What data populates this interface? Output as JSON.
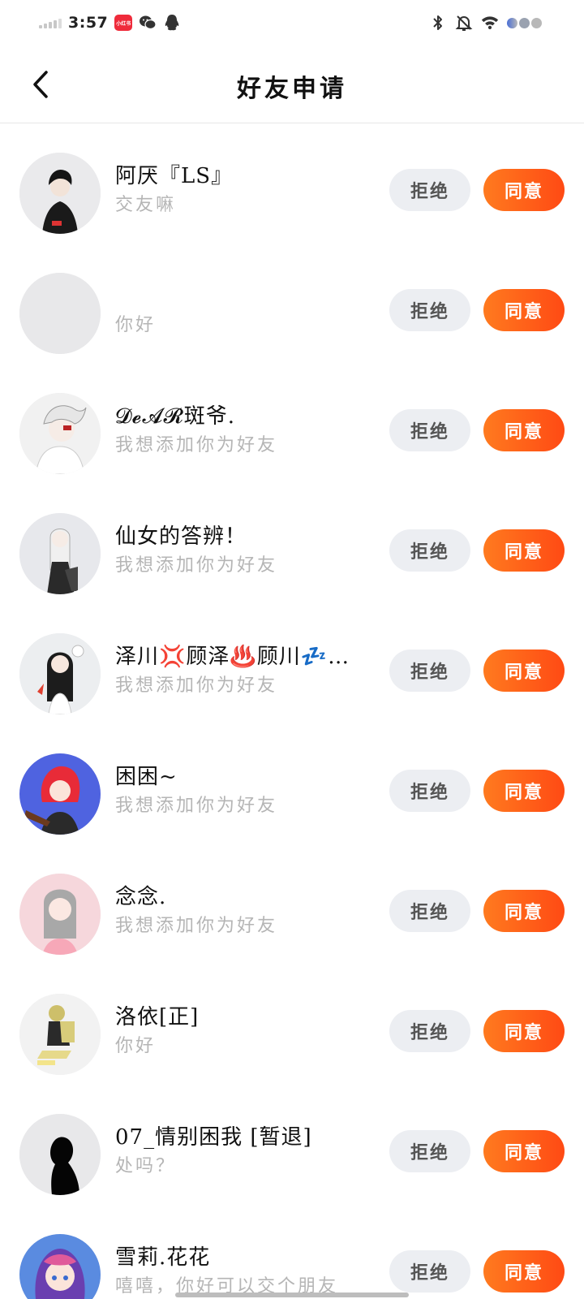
{
  "status_bar": {
    "time": "3:57",
    "app_badge": "小红书",
    "colors": {
      "app_badge": "#ef2b3b",
      "signal": "#c8c8c8"
    }
  },
  "header": {
    "title": "好友申请",
    "back_icon": "chevron-left-icon"
  },
  "requests": [
    {
      "name": "阿厌『LS』",
      "message": "交友嘛",
      "avatar": "anime-boy-black-hoodie"
    },
    {
      "name": "",
      "message": "你好",
      "avatar": "empty-gray"
    },
    {
      "name": "𝓓𝓮𝓐𝓡斑爷.",
      "message": "我想添加你为好友",
      "avatar": "anime-white-hair"
    },
    {
      "name": "仙女的答辨！",
      "message": "我想添加你为好友",
      "avatar": "anime-silver-hair-chair"
    },
    {
      "name": "泽川💢顾泽♨️顾川💤…",
      "message": "我想添加你为好友",
      "avatar": "anime-girl-long-black-hair"
    },
    {
      "name": "困困~",
      "message": "我想添加你为好友",
      "avatar": "anime-red-hair-guitar"
    },
    {
      "name": "念念.",
      "message": "我想添加你为好友",
      "avatar": "anime-gray-hair-pink"
    },
    {
      "name": "洛依[正]",
      "message": "你好",
      "avatar": "anime-blonde-sitting"
    },
    {
      "name": "07_情别困我 [暂退]",
      "message": "处吗？",
      "avatar": "silhouette-black"
    },
    {
      "name": "雪莉.花花",
      "message": "嘻嘻，你好可以交个朋友",
      "avatar": "anime-purple-hair"
    }
  ],
  "buttons": {
    "reject_label": "拒绝",
    "accept_label": "同意",
    "colors": {
      "reject_bg": "#eceef2",
      "accept_from": "#ff7a1f",
      "accept_to": "#ff4a14"
    }
  }
}
